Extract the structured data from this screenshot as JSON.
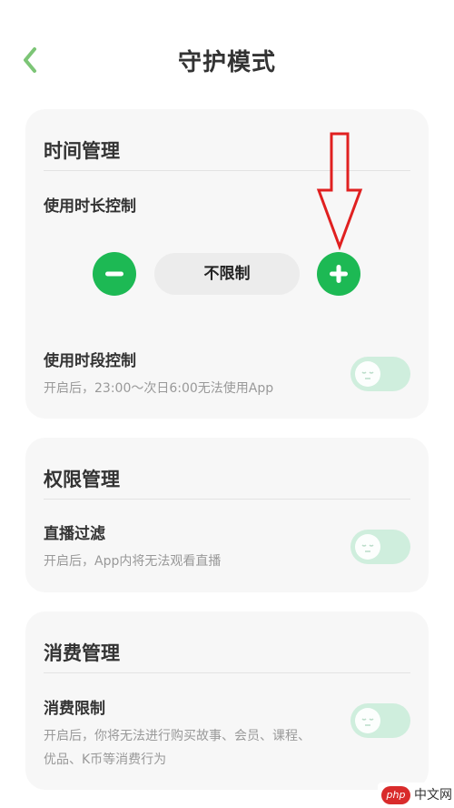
{
  "header": {
    "title": "守护模式"
  },
  "time_card": {
    "title": "时间管理",
    "duration": {
      "label": "使用时长控制",
      "value": "不限制"
    },
    "period": {
      "label": "使用时段控制",
      "description": "开启后，23:00～次日6:00无法使用App",
      "enabled": false
    }
  },
  "permission_card": {
    "title": "权限管理",
    "live": {
      "label": "直播过滤",
      "description": "开启后，App内将无法观看直播",
      "enabled": false
    }
  },
  "spend_card": {
    "title": "消费管理",
    "limit": {
      "label": "消费限制",
      "description_line1": "开启后，你将无法进行购买故事、会员、课程、",
      "description_line2": "优品、K币等消费行为",
      "enabled": false
    }
  },
  "watermark": {
    "logo": "php",
    "text": "中文网"
  },
  "colors": {
    "accent": "#1db954",
    "toggle_off": "#cfeedd",
    "card_bg": "#f7f7f7",
    "arrow": "#e02020"
  }
}
